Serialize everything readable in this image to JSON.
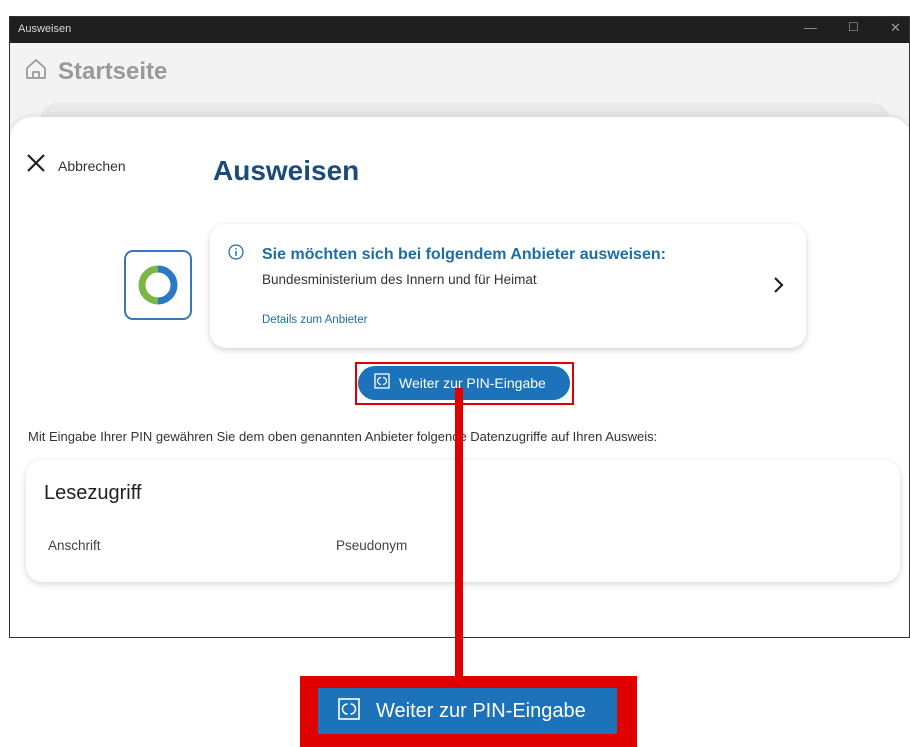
{
  "window": {
    "title": "Ausweisen"
  },
  "header": {
    "home_label": "Startseite"
  },
  "dialog": {
    "cancel_label": "Abbrechen",
    "title": "Ausweisen"
  },
  "provider_card": {
    "heading": "Sie möchten sich bei folgendem Anbieter ausweisen:",
    "provider_name": "Bundesministerium des Innern und für Heimat",
    "details_link": "Details zum Anbieter"
  },
  "pin_button": {
    "label": "Weiter zur PIN-Eingabe"
  },
  "consent_text": "Mit Eingabe Ihrer PIN gewähren Sie dem oben genannten Anbieter folgende Datenzugriffe auf Ihren Ausweis:",
  "access_card": {
    "heading": "Lesezugriff",
    "items": [
      "Anschrift",
      "Pseudonym"
    ]
  },
  "annotation": {
    "zoomed_label": "Weiter zur PIN-Eingabe"
  },
  "colors": {
    "accent": "#1c73b9",
    "title_blue": "#1a4b7a",
    "link_blue": "#1c6ea4",
    "highlight_red": "#e00000"
  }
}
